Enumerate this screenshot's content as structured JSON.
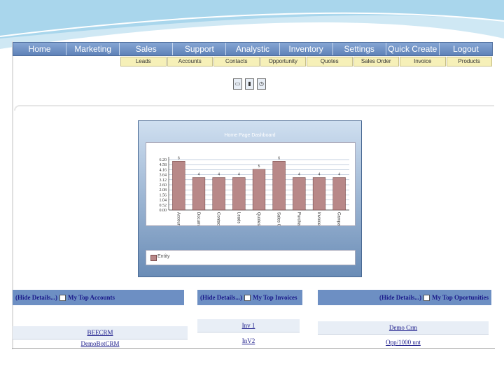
{
  "main_nav": [
    "Home",
    "Marketing",
    "Sales",
    "Support",
    "Analystic",
    "Inventory",
    "Settings",
    "Quick Create",
    "Logout"
  ],
  "sub_nav": [
    "Leads",
    "Accounts",
    "Contacts",
    "Opportunity",
    "Quotes",
    "Sales Order",
    "Invoice",
    "Products"
  ],
  "dashboard": {
    "title": "Home Page Dashboard",
    "legend": "Entity",
    "chart_data": {
      "type": "bar",
      "categories": [
        "Accounts",
        "Documents",
        "Contacts",
        "Leads",
        "Quotes",
        "Sales Order",
        "Purchase Order",
        "Invoices",
        "Campaign"
      ],
      "values": [
        6,
        4,
        4,
        4,
        5,
        6,
        4,
        4,
        4
      ],
      "yticks": [
        "6.20",
        "4.58",
        "4.16",
        "3.64",
        "3.12",
        "2.60",
        "2.08",
        "1.56",
        "1.04",
        "0.52",
        "0.00"
      ],
      "ylim": [
        0,
        6.2
      ],
      "bar_color": "#b88888"
    }
  },
  "panels": [
    {
      "hide": "(Hide Details...)",
      "title": "My Top Accounts",
      "rows": [
        "BEECRM",
        "DemoBotCRM"
      ]
    },
    {
      "hide": "(Hide Details...)",
      "title": "My Top Invoices",
      "rows": [
        "Inv 1",
        "InV2"
      ]
    },
    {
      "hide": "(Hide Details...)",
      "title": "My Top Oportunities",
      "rows": [
        "Demo Crm",
        "Opp/1000 unt"
      ]
    }
  ],
  "colors": {
    "nav": "#6d8fc3",
    "subnav": "#f6f0b8",
    "link": "#1a1a8a"
  }
}
